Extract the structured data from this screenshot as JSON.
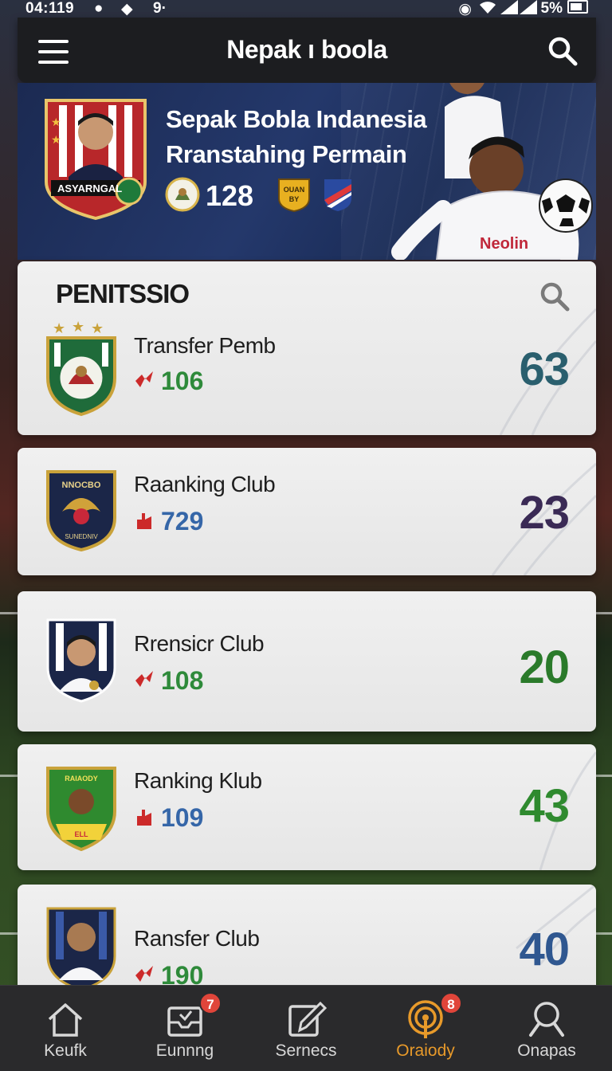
{
  "status_bar": {
    "time": "04:119",
    "extra": "9·",
    "battery": "5%"
  },
  "app_bar": {
    "title": "Nepak ı boola"
  },
  "hero": {
    "title_line1": "Sepak Bobla Indanesia",
    "title_line2": "Rranstahing Permain",
    "count": "128",
    "badge_text": "ASYARNGAL",
    "small_badge": "OUAN BY",
    "jersey_text": "Neolin"
  },
  "section": {
    "title": "PENITSSIO"
  },
  "items": [
    {
      "label": "Transfer Pemb",
      "stat": "106",
      "score": "63",
      "stat_color": "#2e8a3a",
      "score_color": "#2a5f6e",
      "crest": "green-shield"
    },
    {
      "label": "Raanking Club",
      "stat": "729",
      "score": "23",
      "stat_color": "#3566a8",
      "score_color": "#3a2a55",
      "crest": "navy-eagle",
      "crest_text": "NNOCBO"
    },
    {
      "label": "Rrensicr Club",
      "stat": "108",
      "score": "20",
      "stat_color": "#2e8a3a",
      "score_color": "#2a7a2a",
      "crest": "striped-player"
    },
    {
      "label": "Ranking Klub",
      "stat": "109",
      "score": "43",
      "stat_color": "#3566a8",
      "score_color": "#2f8a2f",
      "crest": "green-yellow-player"
    },
    {
      "label": "Ransfer Club",
      "stat": "190",
      "score": "40",
      "stat_color": "#2e8a3a",
      "score_color": "#2f5790",
      "crest": "navy-player"
    }
  ],
  "bottom_nav": [
    {
      "label": "Keufk",
      "icon": "home-icon"
    },
    {
      "label": "Eunnng",
      "icon": "inbox-icon",
      "badge": "7"
    },
    {
      "label": "Sernecs",
      "icon": "edit-icon"
    },
    {
      "label": "Oraiody",
      "icon": "broadcast-icon",
      "badge": "8",
      "active": true
    },
    {
      "label": "Onapas",
      "icon": "search-icon"
    }
  ],
  "colors": {
    "accent": "#e89a2a",
    "badge": "#e0453a",
    "appbar": "#1c1d20",
    "hero": "#1b2a52"
  }
}
